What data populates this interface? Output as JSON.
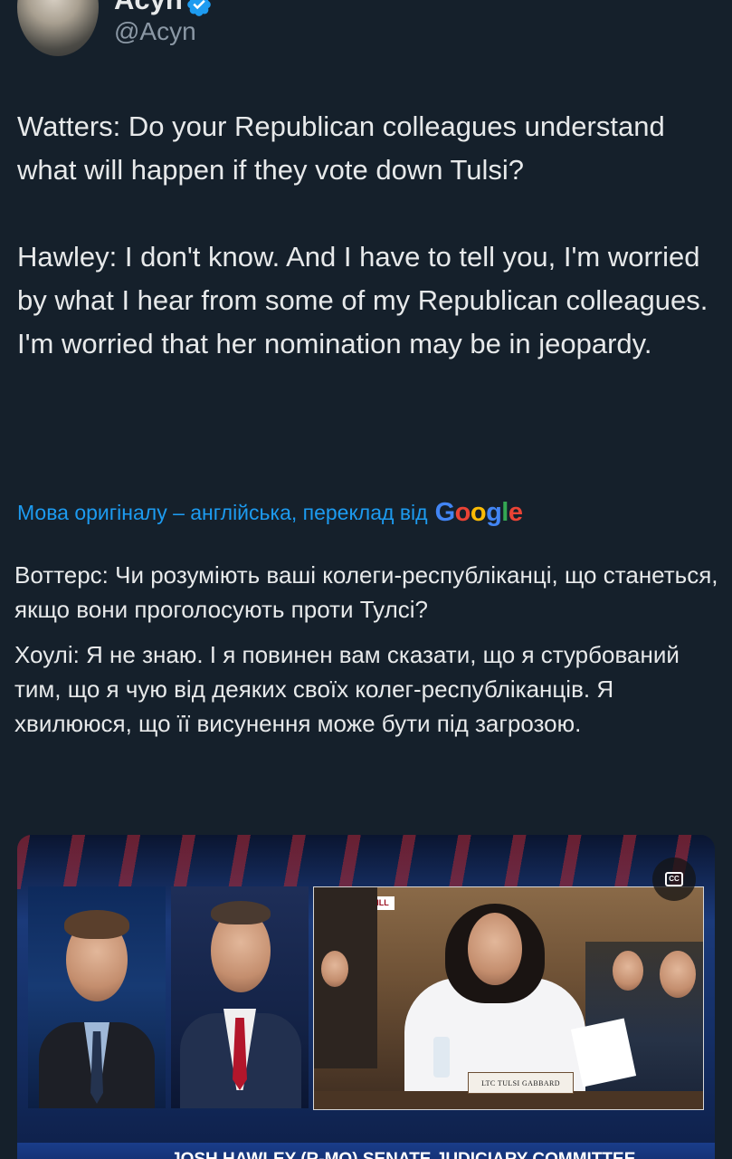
{
  "author": {
    "display_name": "Acyn",
    "handle": "@Acyn",
    "verified": true,
    "avatar_icon": "avatar-photo"
  },
  "tweet": {
    "paragraphs": [
      "Watters: Do your Republican colleagues understand what will happen if they vote down Tulsi?",
      "Hawley: I don't know. And I have to tell you, I'm worried by what I hear from some of my Republican colleagues. I'm worried that her nomination may be in jeopardy."
    ]
  },
  "translation": {
    "note": "Мова оригіналу – англійська, переклад від",
    "provider": "Google",
    "paragraphs": [
      "Воттерс: Чи розуміють ваші колеги-республіканці, що станеться, якщо вони проголосують проти Тулсі?",
      "Хоулі: Я не знаю. І я повинен вам сказати, що я стурбований тим, що я чую від деяких своїх колег-республіканців. Я хвилююся, що її висунення може бути під загрозою."
    ]
  },
  "media": {
    "type": "video",
    "cc_icon": "closed-captions-icon",
    "cc_label": "CC",
    "on_screen": {
      "location_tag": "CAPITOL HILL",
      "nameplate": "LTC TULSI GABBARD",
      "chyron": "JOSH HAWLEY (R-MO) SENATE JUDICIARY COMMITTEE"
    }
  },
  "colors": {
    "background": "#15202b",
    "text": "#e7e9ea",
    "secondary_text": "#8b98a5",
    "link": "#1d9bf0",
    "verified": "#1d9bf0"
  }
}
